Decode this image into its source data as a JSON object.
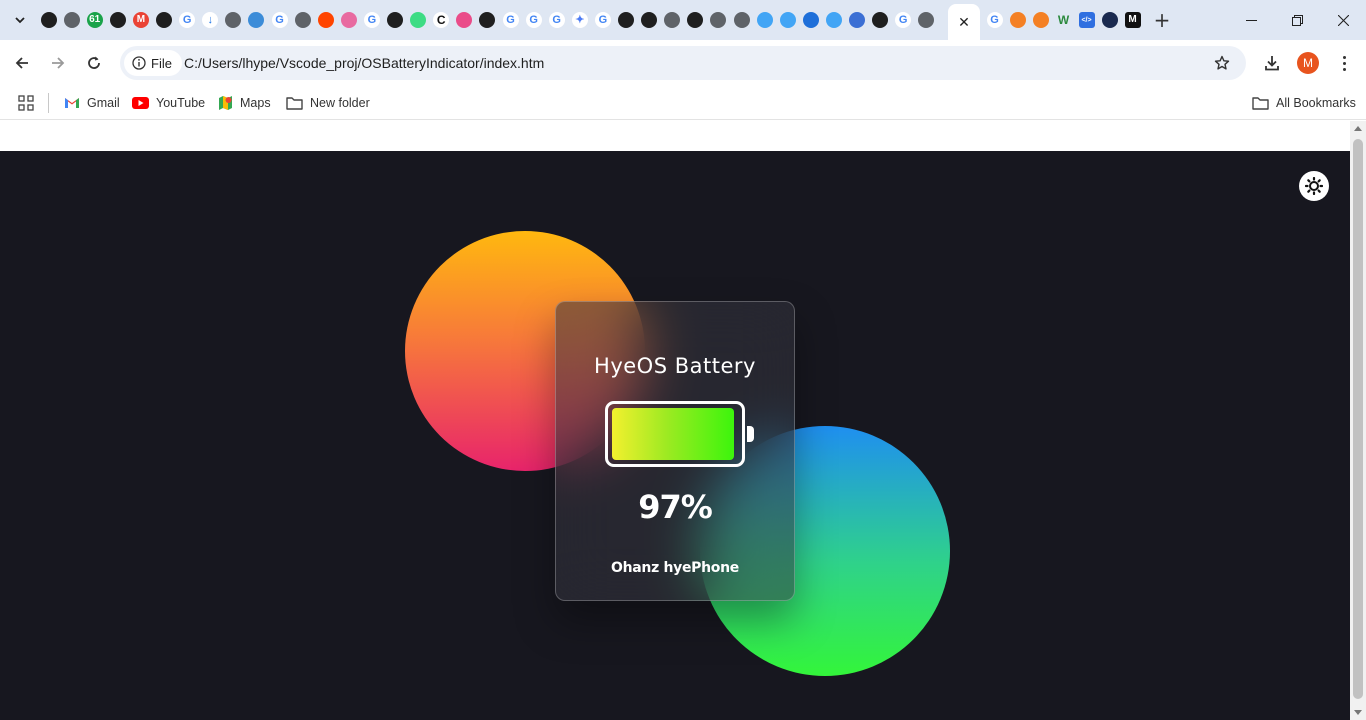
{
  "browser": {
    "tabs": [
      {
        "icon": "github-icon",
        "color": "#1f1f1f",
        "glyph": ""
      },
      {
        "icon": "globe-icon",
        "color": "#5f6368",
        "glyph": ""
      },
      {
        "icon": "badge-61-icon",
        "color": "#1aa34a",
        "glyph": "61"
      },
      {
        "icon": "github-icon",
        "color": "#1f1f1f",
        "glyph": ""
      },
      {
        "icon": "gmail-icon",
        "color": "#ea4335",
        "glyph": "M"
      },
      {
        "icon": "github-icon",
        "color": "#1f1f1f",
        "glyph": ""
      },
      {
        "icon": "google-icon",
        "color": "#4285f4",
        "glyph": "G"
      },
      {
        "icon": "download-icon",
        "color": "#1a73e8",
        "glyph": "↓"
      },
      {
        "icon": "globe-icon",
        "color": "#5f6368",
        "glyph": ""
      },
      {
        "icon": "chart-icon",
        "color": "#3c8cd8",
        "glyph": ""
      },
      {
        "icon": "google-icon",
        "color": "#4285f4",
        "glyph": "G"
      },
      {
        "icon": "globe-icon",
        "color": "#5f6368",
        "glyph": ""
      },
      {
        "icon": "reddit-icon",
        "color": "#ff4500",
        "glyph": ""
      },
      {
        "icon": "brain-icon",
        "color": "#e86aa0",
        "glyph": ""
      },
      {
        "icon": "google-icon",
        "color": "#4285f4",
        "glyph": "G"
      },
      {
        "icon": "github-icon",
        "color": "#1f1f1f",
        "glyph": ""
      },
      {
        "icon": "android-icon",
        "color": "#3ddc84",
        "glyph": ""
      },
      {
        "icon": "c-icon",
        "color": "#111111",
        "glyph": "C"
      },
      {
        "icon": "dribbble-icon",
        "color": "#ea4c89",
        "glyph": ""
      },
      {
        "icon": "github-icon",
        "color": "#1f1f1f",
        "glyph": ""
      },
      {
        "icon": "google-icon",
        "color": "#4285f4",
        "glyph": "G"
      },
      {
        "icon": "google-icon",
        "color": "#4285f4",
        "glyph": "G"
      },
      {
        "icon": "google-icon",
        "color": "#4285f4",
        "glyph": "G"
      },
      {
        "icon": "gemini-icon",
        "color": "#4d7cf5",
        "glyph": "✦"
      },
      {
        "icon": "google-icon",
        "color": "#4285f4",
        "glyph": "G"
      },
      {
        "icon": "openai-icon",
        "color": "#1f1f1f",
        "glyph": ""
      },
      {
        "icon": "openai-icon",
        "color": "#1f1f1f",
        "glyph": ""
      },
      {
        "icon": "globe-search-icon",
        "color": "#5f6368",
        "glyph": ""
      },
      {
        "icon": "openai-icon",
        "color": "#1f1f1f",
        "glyph": ""
      },
      {
        "icon": "globe-icon",
        "color": "#5f6368",
        "glyph": ""
      },
      {
        "icon": "globe-icon",
        "color": "#5f6368",
        "glyph": ""
      },
      {
        "icon": "flutter-icon",
        "color": "#42a5f5",
        "glyph": ""
      },
      {
        "icon": "flutter-icon",
        "color": "#42a5f5",
        "glyph": ""
      },
      {
        "icon": "vs-icon",
        "color": "#1e6fd9",
        "glyph": ""
      },
      {
        "icon": "flutter-icon",
        "color": "#42a5f5",
        "glyph": ""
      },
      {
        "icon": "history-icon",
        "color": "#3b6fd4",
        "glyph": ""
      },
      {
        "icon": "github-icon",
        "color": "#1f1f1f",
        "glyph": ""
      },
      {
        "icon": "google-icon",
        "color": "#4285f4",
        "glyph": "G"
      },
      {
        "icon": "globe-icon",
        "color": "#5f6368",
        "glyph": ""
      }
    ],
    "tabs_after_active": [
      {
        "icon": "google-icon",
        "color": "#4285f4",
        "glyph": "G"
      },
      {
        "icon": "stackoverflow-icon",
        "color": "#f48024",
        "glyph": ""
      },
      {
        "icon": "stackoverflow-icon",
        "color": "#f48024",
        "glyph": ""
      },
      {
        "icon": "webflow-w-icon",
        "color": "#2c8a3e",
        "glyph": "W"
      },
      {
        "icon": "code-icon",
        "color": "#2f6fe0",
        "glyph": "</>"
      },
      {
        "icon": "ninja-icon",
        "color": "#1a2a4f",
        "glyph": ""
      },
      {
        "icon": "medium-icon",
        "color": "#111111",
        "glyph": "M"
      }
    ],
    "url_chip_label": "File",
    "url": "C:/Users/lhype/Vscode_proj/OSBatteryIndicator/index.htm",
    "profile_initial": "M",
    "profile_color": "#e8541e",
    "bookmarks": [
      {
        "label": "Gmail",
        "icon": "gmail-icon"
      },
      {
        "label": "YouTube",
        "icon": "youtube-icon"
      },
      {
        "label": "Maps",
        "icon": "maps-icon"
      },
      {
        "label": "New folder",
        "icon": "folder-icon"
      }
    ],
    "all_bookmarks_label": "All Bookmarks"
  },
  "app": {
    "title": "HyeOS Battery",
    "percentage_text": "97%",
    "level": 0.97,
    "device_name": "Ohanz hyePhone",
    "background_color": "#17171f",
    "blob_warm_colors": [
      "#ffb80f",
      "#f7793a",
      "#e8246b"
    ],
    "blob_cool_colors": [
      "#1f8ff0",
      "#2fd28a",
      "#33f53a"
    ],
    "battery_fill_colors": [
      "#f3f02e",
      "#9dea22",
      "#3cf50c"
    ],
    "theme_toggle_icon": "sun-icon"
  }
}
